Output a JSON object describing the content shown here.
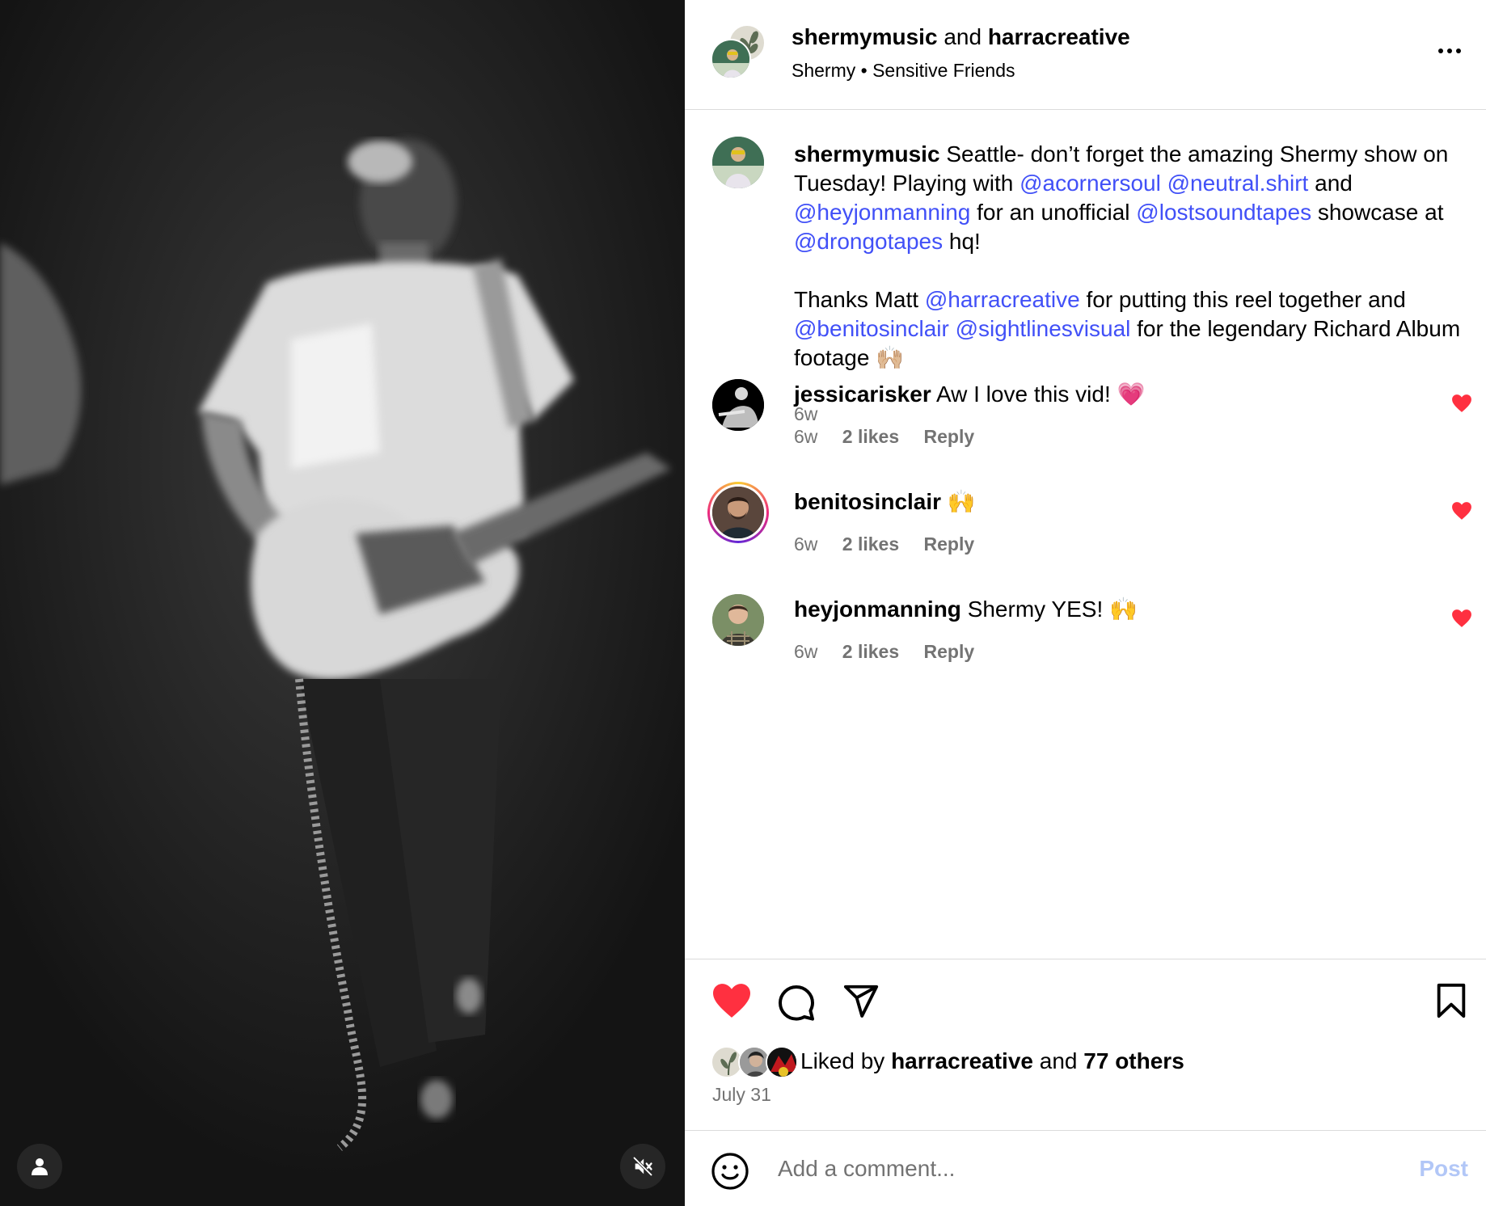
{
  "media": {
    "tag_icon": "person-tag-icon",
    "mute_icon": "speaker-muted-icon"
  },
  "header": {
    "author1": "shermymusic",
    "joiner": "and",
    "author2": "harracreative",
    "audio_artist": "Shermy",
    "separator": "•",
    "audio_title": "Sensitive Friends",
    "more_icon": "more-horizontal-icon"
  },
  "caption": {
    "username": "shermymusic",
    "t1": "Seattle- don’t forget the amazing Shermy show on Tuesday! Playing with ",
    "m1": "@acornersoul",
    "m2": "@neutral.shirt",
    "t2": " and ",
    "m3": "@heyjonmanning",
    "t3": " for an unofficial ",
    "m4": "@lostsoundtapes",
    "t4": " showcase at ",
    "m5": "@drongotapes",
    "t5": " hq!",
    "t6": "Thanks Matt ",
    "m6": "@harracreative",
    "t7": " for putting this reel together and ",
    "m7": "@benitosinclair",
    "m8": "@sightlinesvisual",
    "t8": " for the legendary Richard Album footage ",
    "emoji": "🙌🏼",
    "time": "6w"
  },
  "comments": [
    {
      "username": "jessicarisker",
      "text": "Aw I love this vid!",
      "emoji": "💗",
      "time": "6w",
      "likes": "2 likes",
      "reply": "Reply"
    },
    {
      "username": "benitosinclair",
      "text": "",
      "emoji": "🙌",
      "time": "6w",
      "likes": "2 likes",
      "reply": "Reply"
    },
    {
      "username": "heyjonmanning",
      "text": "Shermy YES!",
      "emoji": "🙌",
      "time": "6w",
      "likes": "2 likes",
      "reply": "Reply"
    }
  ],
  "actions": {
    "like_icon": "heart-filled-icon",
    "comment_icon": "comment-bubble-icon",
    "share_icon": "paper-plane-icon",
    "save_icon": "bookmark-icon",
    "liked_prefix": "Liked by",
    "liked_user": "harracreative",
    "liked_and": "and",
    "liked_others": "77 others",
    "date": "July 31"
  },
  "composer": {
    "placeholder": "Add a comment...",
    "post_label": "Post",
    "emoji_icon": "smiley-icon"
  },
  "colors": {
    "like_red": "#ff3040",
    "mention_blue": "#4150f7",
    "muted_gray": "#737373",
    "post_disabled": "#b2c7f7"
  }
}
